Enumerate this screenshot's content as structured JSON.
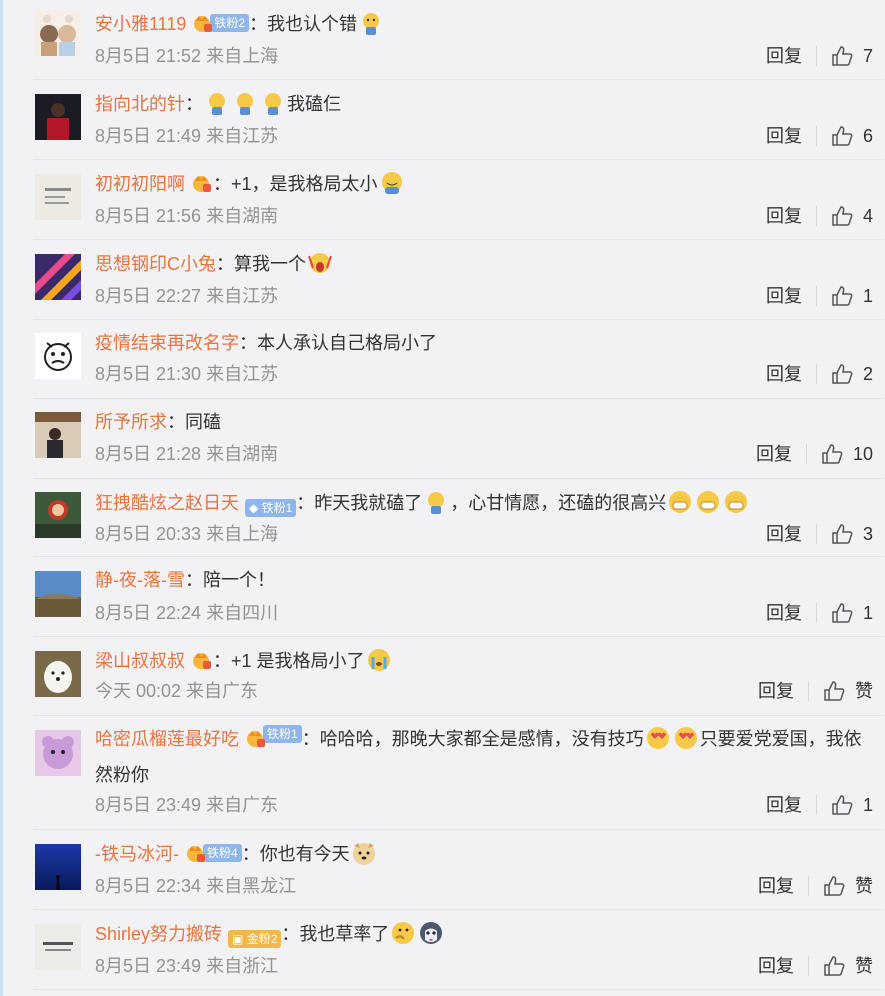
{
  "reply_label": "回复",
  "comments": [
    {
      "user": "安小雅1119",
      "badge": "crown-fan",
      "fan": "铁粉2",
      "sep": "：",
      "text": "我也认个错",
      "emojis_after": [
        "cry"
      ],
      "time": "8月5日 21:52 来自上海",
      "likes": "7"
    },
    {
      "user": "指向北的针",
      "badge": "",
      "fan": "",
      "sep": "：",
      "text_before_emojis": [
        "cry",
        "cry",
        "cry"
      ],
      "text": "我磕仨",
      "time": "8月5日 21:49 来自江苏",
      "likes": "6"
    },
    {
      "user": "初初初阳啊",
      "badge": "crown",
      "fan": "",
      "sep": "：",
      "text": "+1，是我格局太小",
      "emojis_after": [
        "smile-sweat"
      ],
      "time": "8月5日 21:56 来自湖南",
      "likes": "4"
    },
    {
      "user": "思想钢印C小兔",
      "badge": "",
      "fan": "",
      "sep": "：",
      "text": "算我一个",
      "emojis_after": [
        "scream"
      ],
      "time": "8月5日 22:27 来自江苏",
      "likes": "1"
    },
    {
      "user": "疫情结束再改名字",
      "badge": "",
      "fan": "",
      "sep": "：",
      "text": "本人承认自己格局小了",
      "emojis_after": [],
      "time": "8月5日 21:30 来自江苏",
      "likes": "2"
    },
    {
      "user": "所予所求",
      "badge": "",
      "fan": "",
      "sep": "：",
      "text": "同磕",
      "emojis_after": [],
      "time": "8月5日 21:28 来自湖南",
      "likes": "10"
    },
    {
      "user": "狂拽酷炫之赵日天",
      "badge": "diamond-fan",
      "fan": "铁粉1",
      "sep": "：",
      "text": "昨天我就磕了",
      "text2": "，心甘情愿，还磕的很高兴",
      "emojis_mid": [
        "cry"
      ],
      "emojis_after": [
        "grin",
        "grin",
        "grin"
      ],
      "time": "8月5日 20:33 来自上海",
      "likes": "3"
    },
    {
      "user": "静-夜-落-雪",
      "badge": "",
      "fan": "",
      "sep": "：",
      "text": "陪一个！",
      "emojis_after": [],
      "time": "8月5日 22:24 来自四川",
      "likes": "1"
    },
    {
      "user": "梁山叔叔叔",
      "badge": "crown",
      "fan": "",
      "sep": "：",
      "text": "+1 是我格局小了",
      "emojis_after": [
        "tears"
      ],
      "time": "今天 00:02 来自广东",
      "likes": "赞"
    },
    {
      "user": "哈密瓜榴莲最好吃",
      "badge": "crown-fan",
      "fan": "铁粉1",
      "sep": "：",
      "text": "哈哈哈，那晚大家都全是感情，没有技巧",
      "text2": "只要爱党爱国，我依然粉你",
      "emojis_mid": [
        "love",
        "love"
      ],
      "emojis_after": [],
      "time": "8月5日 23:49 来自广东",
      "likes": "1"
    },
    {
      "user": "-铁马冰河-",
      "badge": "crown-fan",
      "fan": "铁粉4",
      "sep": "：",
      "text": "你也有今天",
      "emojis_after": [
        "doge"
      ],
      "time": "8月5日 22:34 来自黑龙江",
      "likes": "赞"
    },
    {
      "user": "Shirley努力搬砖",
      "badge": "gold-fan",
      "fan": "金粉2",
      "sep": "：",
      "text": "我也草率了",
      "emojis_after": [
        "think",
        "husky"
      ],
      "time": "8月5日 23:49 来自浙江",
      "likes": "赞"
    }
  ],
  "colors": {
    "username": "#e8743e",
    "meta": "#939393",
    "text": "#333333",
    "bg": "#f2f2f5"
  }
}
